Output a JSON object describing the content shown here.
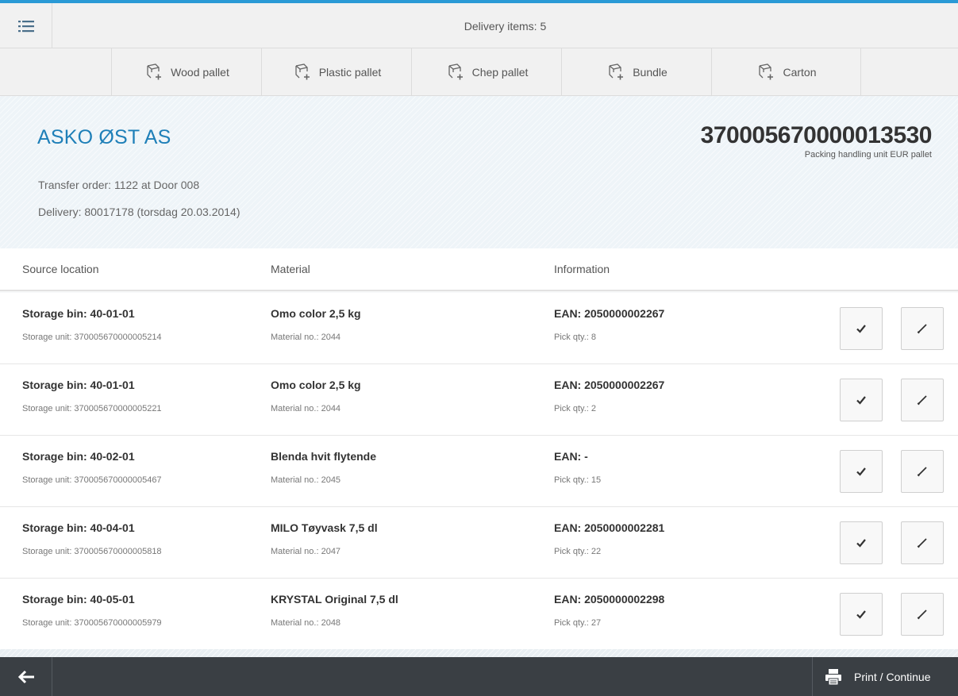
{
  "app": {
    "title": "Delivery items: 5"
  },
  "toolbar": {
    "buttons": [
      {
        "label": "Wood pallet",
        "icon": "add-package-icon"
      },
      {
        "label": "Plastic pallet",
        "icon": "add-package-icon"
      },
      {
        "label": "Chep pallet",
        "icon": "add-package-icon"
      },
      {
        "label": "Bundle",
        "icon": "add-package-icon"
      },
      {
        "label": "Carton",
        "icon": "add-package-icon"
      }
    ]
  },
  "header": {
    "customer": "ASKO ØST AS",
    "transfer_order": "Transfer order: 1122 at Door 008",
    "delivery": "Delivery: 80017178 (torsdag 20.03.2014)",
    "handling_unit": "370005670000013530",
    "handling_unit_desc": "Packing handling unit EUR pallet"
  },
  "table": {
    "columns": [
      "Source location",
      "Material",
      "Information"
    ],
    "rows": [
      {
        "bin": "Storage bin: 40-01-01",
        "unit": "Storage unit: 370005670000005214",
        "material": "Omo color 2,5 kg",
        "material_no": "Material no.: 2044",
        "ean": "EAN: 2050000002267",
        "qty": "Pick qty.: 8"
      },
      {
        "bin": "Storage bin: 40-01-01",
        "unit": "Storage unit: 370005670000005221",
        "material": "Omo color 2,5 kg",
        "material_no": "Material no.: 2044",
        "ean": "EAN: 2050000002267",
        "qty": "Pick qty.: 2"
      },
      {
        "bin": "Storage bin: 40-02-01",
        "unit": "Storage unit: 370005670000005467",
        "material": "Blenda hvit flytende",
        "material_no": "Material no.: 2045",
        "ean": "EAN: -",
        "qty": "Pick qty.: 15"
      },
      {
        "bin": "Storage bin: 40-04-01",
        "unit": "Storage unit: 370005670000005818",
        "material": "MILO Tøyvask 7,5 dl",
        "material_no": "Material no.: 2047",
        "ean": "EAN: 2050000002281",
        "qty": "Pick qty.: 22"
      },
      {
        "bin": "Storage bin: 40-05-01",
        "unit": "Storage unit: 370005670000005979",
        "material": "KRYSTAL Original 7,5 dl",
        "material_no": "Material no.: 2048",
        "ean": "EAN: 2050000002298",
        "qty": "Pick qty.: 27"
      }
    ]
  },
  "footer": {
    "print_label": "Print / Continue"
  },
  "colors": {
    "accent": "#2a9ad6",
    "customer_title": "#1e7fb8",
    "footer_bg": "#3a3f44"
  }
}
